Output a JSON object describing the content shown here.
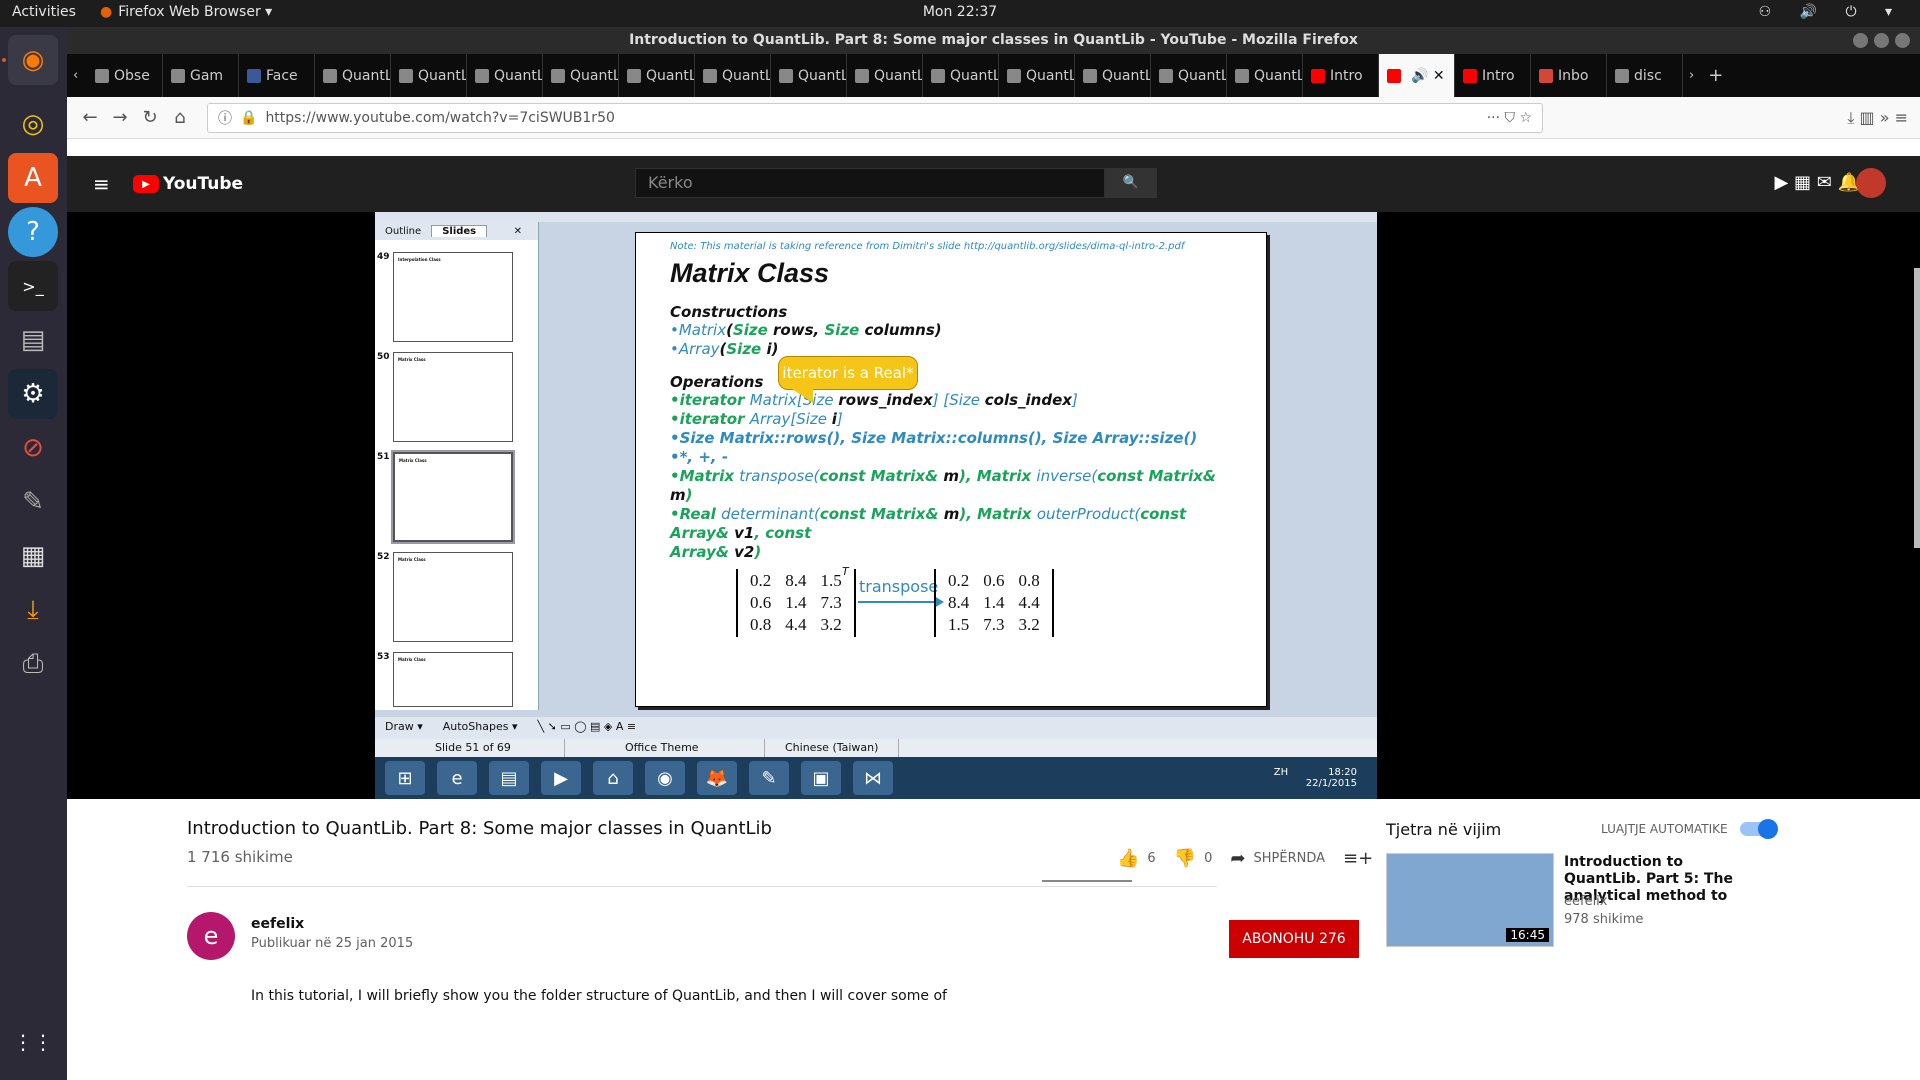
{
  "topbar": {
    "activities": "Activities",
    "app_menu": "Firefox Web Browser ▾",
    "clock": "Mon 22:37",
    "tray": "⚇ 🔊 ⏻ ▾"
  },
  "dock": {
    "items": [
      "firefox-icon",
      "music-icon",
      "store-icon",
      "help-icon",
      "terminal-icon",
      "files-icon",
      "steam-icon",
      "blocked-icon",
      "gimp-icon",
      "video-icon",
      "download-icon",
      "printer-icon"
    ]
  },
  "window": {
    "title": "Introduction to QuantLib. Part 8: Some major classes in QuantLib - YouTube - Mozilla Firefox"
  },
  "tabs": [
    "Obse",
    "Gam",
    "Face",
    "QuantLi",
    "QuantLi",
    "QuantLi",
    "QuantLi",
    "QuantLi",
    "QuantLi",
    "QuantLi",
    "QuantLi",
    "QuantLi",
    "QuantLi",
    "QuantLi",
    "QuantLi",
    "QuantLi",
    "Intro",
    "",
    "Intro",
    "Inbo",
    "disc"
  ],
  "nav": {
    "url": "https://www.youtube.com/watch?v=7ciSWUB1r50",
    "back": "←",
    "forward": "→",
    "reload": "↻",
    "home": "⌂",
    "more": "··· ⛉ ☆",
    "right_icons": "⤓ ▥ »  ≡"
  },
  "youtube": {
    "logo": "YouTube",
    "search_placeholder": "Kërko",
    "search_btn": "🔍",
    "header_icons": "▶ ▦ ✉ 🔔"
  },
  "slide": {
    "note": "Note: This material is taking reference from Dimitri's slide http://quantlib.org/slides/dima-ql-intro-2.pdf",
    "title": "Matrix Class",
    "constructions": "Constructions",
    "c1a": "•Matrix",
    "c1b": "(",
    "c1c": "Size",
    "c1d": " rows, ",
    "c1e": "Size",
    "c1f": " columns)",
    "c2a": "•Array",
    "c2b": "(",
    "c2c": "Size",
    "c2d": " i)",
    "operations": "Operations",
    "callout": "iterator is a Real*",
    "o1a": "•iterator ",
    "o1b": "Matrix[Size ",
    "o1c": "rows_index",
    "o1d": "] [Size ",
    "o1e": "cols_index",
    "o1f": "]",
    "o2a": "•iterator ",
    "o2b": "Array[Size ",
    "o2c": "i",
    "o2d": "]",
    "o3": "•Size  Matrix::rows(), Size  Matrix::columns(), Size  Array::size()",
    "o4": "•*, +, -",
    "o5a": "•Matrix ",
    "o5b": "transpose(",
    "o5c": "const Matrix& ",
    "o5d": "m",
    "o5e": "), Matrix ",
    "o5f": "inverse(",
    "o5g": "const Matrix& ",
    "o5h": "m",
    "o5i": ")",
    "o6a": "•Real ",
    "o6b": "determinant(",
    "o6c": "const Matrix& ",
    "o6d": "m",
    "o6e": "), Matrix ",
    "o6f": "outerProduct(",
    "o6g": "const Array& ",
    "o6h": "v1",
    "o6i": ", const",
    "o6j": "Array& ",
    "o6k": "v2",
    "o6l": ")",
    "mat1": [
      [
        "0.2",
        "8.4",
        "1.5"
      ],
      [
        "0.6",
        "1.4",
        "7.3"
      ],
      [
        "0.8",
        "4.4",
        "3.2"
      ]
    ],
    "mat_sup": "T",
    "transpose": "transpose",
    "mat2": [
      [
        "0.2",
        "0.6",
        "0.8"
      ],
      [
        "8.4",
        "1.4",
        "4.4"
      ],
      [
        "1.5",
        "7.3",
        "3.2"
      ]
    ]
  },
  "ppt": {
    "tab_outline": "Outline",
    "tab_slides": "Slides",
    "close": "✕",
    "thumb_nums": [
      "49",
      "50",
      "51",
      "52",
      "53"
    ],
    "thumb_titles": [
      "Interpolation Class",
      "Matrix Class",
      "Matrix Class",
      "Matrix Class",
      "Matrix Class"
    ],
    "draw": "Draw ▾",
    "autoshapes": "AutoShapes ▾",
    "status_slide": "Slide 51 of 69",
    "status_theme": "Office Theme",
    "status_lang": "Chinese (Taiwan)"
  },
  "taskbar": {
    "items": [
      "⊞",
      "e",
      "▤",
      "▶",
      "⌂",
      "◉",
      "🦊",
      "✎",
      "▣",
      "⋈"
    ],
    "lang": "ZH",
    "time": "18:20",
    "date": "22/1/2015"
  },
  "video": {
    "title": "Introduction to QuantLib. Part 8: Some major classes in QuantLib",
    "views": "1 716 shikime",
    "likes": "6",
    "dislikes": "0",
    "share": "SHPËRNDA",
    "add": "≡+",
    "more": "···"
  },
  "channel": {
    "initial": "e",
    "name": "eefelix",
    "published": "Publikuar në 25 jan 2015",
    "subscribe": "ABONOHU  276"
  },
  "description": "In this tutorial, I will briefly show you the folder structure of QuantLib, and then I will cover some of",
  "sidebar": {
    "up_next": "Tjetra në vijim",
    "autoplay": "LUAJTJE AUTOMATIKE",
    "rec_title": "Introduction to QuantLib. Part 5: The analytical method to",
    "rec_channel": "eefelix",
    "rec_views": "978 shikime",
    "rec_duration": "16:45"
  }
}
